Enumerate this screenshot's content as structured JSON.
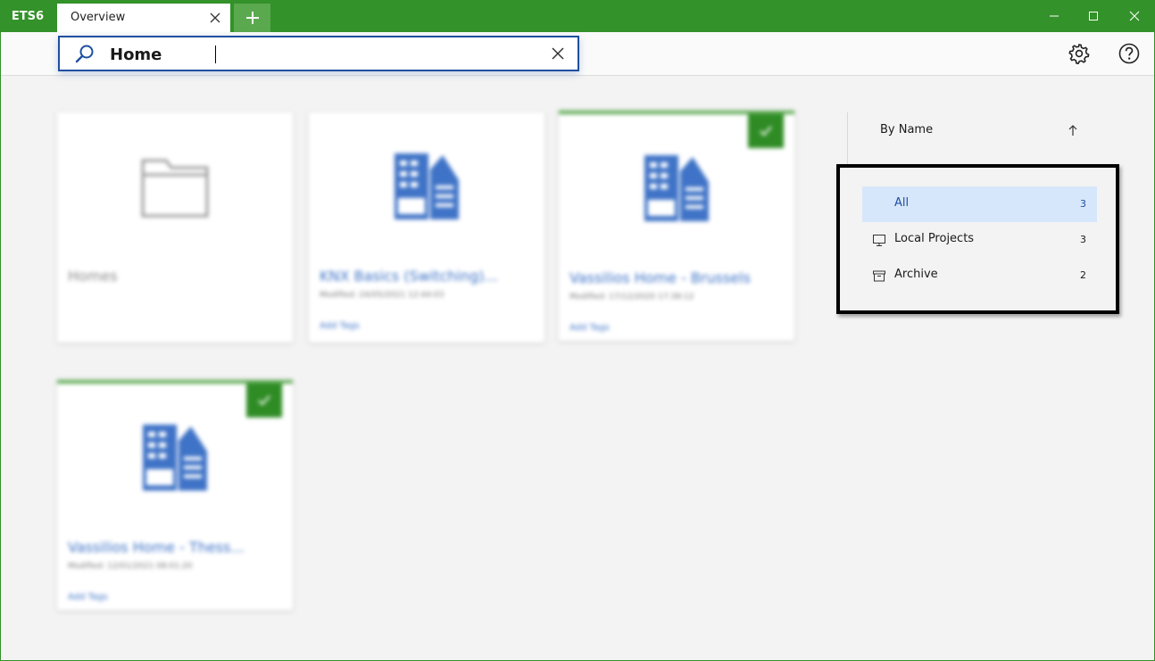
{
  "app": {
    "name": "ETS6"
  },
  "tabs": [
    {
      "label": "Overview"
    }
  ],
  "search": {
    "value": "Home"
  },
  "sort": {
    "label": "By Name"
  },
  "filters": [
    {
      "label": "All",
      "count": "3",
      "icon": "none",
      "selected": true
    },
    {
      "label": "Local Projects",
      "count": "3",
      "icon": "monitor-icon",
      "selected": false
    },
    {
      "label": "Archive",
      "count": "2",
      "icon": "archive-box-icon",
      "selected": false
    }
  ],
  "cards": [
    {
      "title": "Homes",
      "kind": "folder",
      "meta": "",
      "tags": ""
    },
    {
      "title": "KNX Basics (Switching)...",
      "kind": "project",
      "meta": "Modified: 24/05/2021 12:44:03",
      "tags": "Add Tags"
    },
    {
      "title": "Vassilios Home - Brussels",
      "kind": "project",
      "meta": "Modified: 17/12/2020 17:38:12",
      "tags": "Add Tags",
      "active": true
    },
    {
      "title": "Vassilios Home - Thess...",
      "kind": "project",
      "meta": "Modified: 12/01/2021 08:01:20",
      "tags": "Add Tags",
      "active": true
    }
  ],
  "colors": {
    "brand_green": "#339229",
    "accent_blue": "#1e4fa0",
    "selection_blue": "#d7e7fb"
  }
}
